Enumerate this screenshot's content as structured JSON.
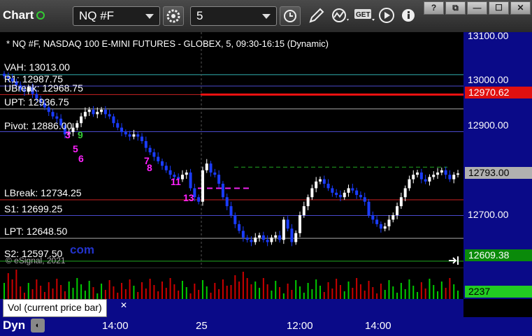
{
  "toolbar": {
    "title": "Chart",
    "symbol": "NQ #F",
    "interval": "5",
    "window_buttons": [
      "?",
      "⧉",
      "—",
      "☐",
      "✕"
    ],
    "get_label": "GET"
  },
  "chart": {
    "header": "* NQ #F, NASDAQ 100 E-MINI FUTURES - GLOBEX, 5, 09:30-16:15 (Dynamic)",
    "levels": [
      {
        "label": "VAH: 13013.00",
        "value": 13013.0
      },
      {
        "label": "R1: 12987.75",
        "value": 12987.75
      },
      {
        "label": "UBreak: 12968.75",
        "value": 12968.75
      },
      {
        "label": "UPT: 12936.75",
        "value": 12936.75
      },
      {
        "label": "Pivot: 12886.00",
        "value": 12886.0
      },
      {
        "label": "LBreak: 12734.25",
        "value": 12734.25
      },
      {
        "label": "S1: 12699.25",
        "value": 12699.25
      },
      {
        "label": "LPT: 12648.50",
        "value": 12648.5
      },
      {
        "label": "S2: 12597.50",
        "value": 12597.5
      }
    ],
    "axis_labels": [
      "13100.00",
      "13000.00",
      "12900.00",
      "12700.00"
    ],
    "price_tags": [
      {
        "text": "12970.62",
        "bg": "#e01010",
        "fg": "#ffffff"
      },
      {
        "text": "12793.00",
        "bg": "#b0b0b0",
        "fg": "#000000"
      },
      {
        "text": "12609.38",
        "bg": "#0a8a0a",
        "fg": "#ffffff"
      }
    ],
    "copyright": "© eSignal, 2021",
    "watermark": "com",
    "count_labels": [
      "3",
      "9",
      "5",
      "6",
      "7",
      "8",
      "11",
      "13"
    ]
  },
  "volume": {
    "label": "Vol (current price bar)",
    "close": "✕",
    "value": "2237"
  },
  "time_axis": {
    "dyn": "Dyn",
    "labels": [
      "14:00",
      "25",
      "12:00",
      "14:00"
    ]
  },
  "colors": {
    "up": "#ffffff",
    "down": "#1a3cff",
    "axis_bg": "#0a0a88",
    "volume_up": "#00cc00",
    "volume_down": "#cc0000"
  }
}
